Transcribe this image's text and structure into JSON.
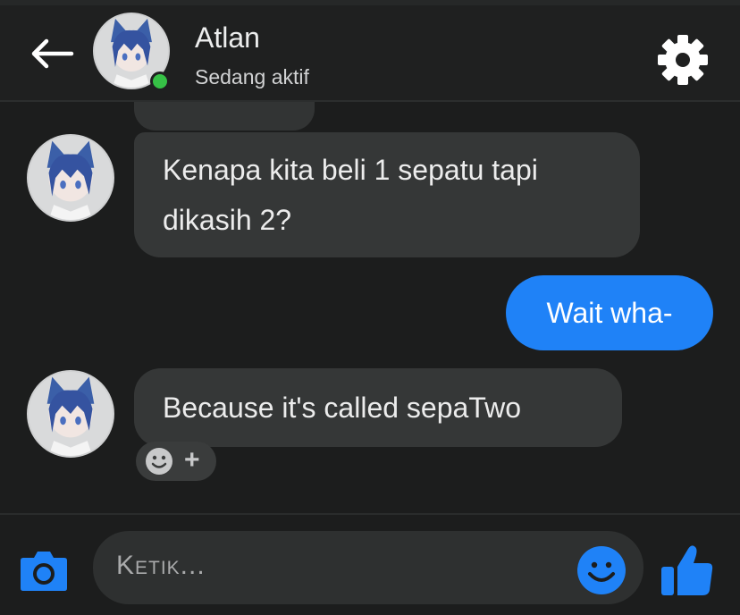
{
  "header": {
    "title": "Atlan",
    "status": "Sedang aktif"
  },
  "messages": [
    {
      "from": "contact",
      "lines": [
        "Kenapa kita beli 1 sepatu tapi",
        "dikasih 2?"
      ]
    },
    {
      "from": "me",
      "text": "Wait wha-"
    },
    {
      "from": "contact",
      "text": "Because it's called sepaTwo"
    }
  ],
  "reaction": {
    "plus": "+"
  },
  "composer": {
    "placeholder": "Ketik..."
  },
  "icons": {
    "back": "arrow-left-icon",
    "settings": "gear-icon",
    "camera": "camera-icon",
    "emoji": "smiley-icon",
    "like": "thumbs-up-icon"
  },
  "colors": {
    "accent": "#1f82f7",
    "online": "#36c146",
    "background": "#1c1d1d",
    "bubble_in": "#353737"
  }
}
